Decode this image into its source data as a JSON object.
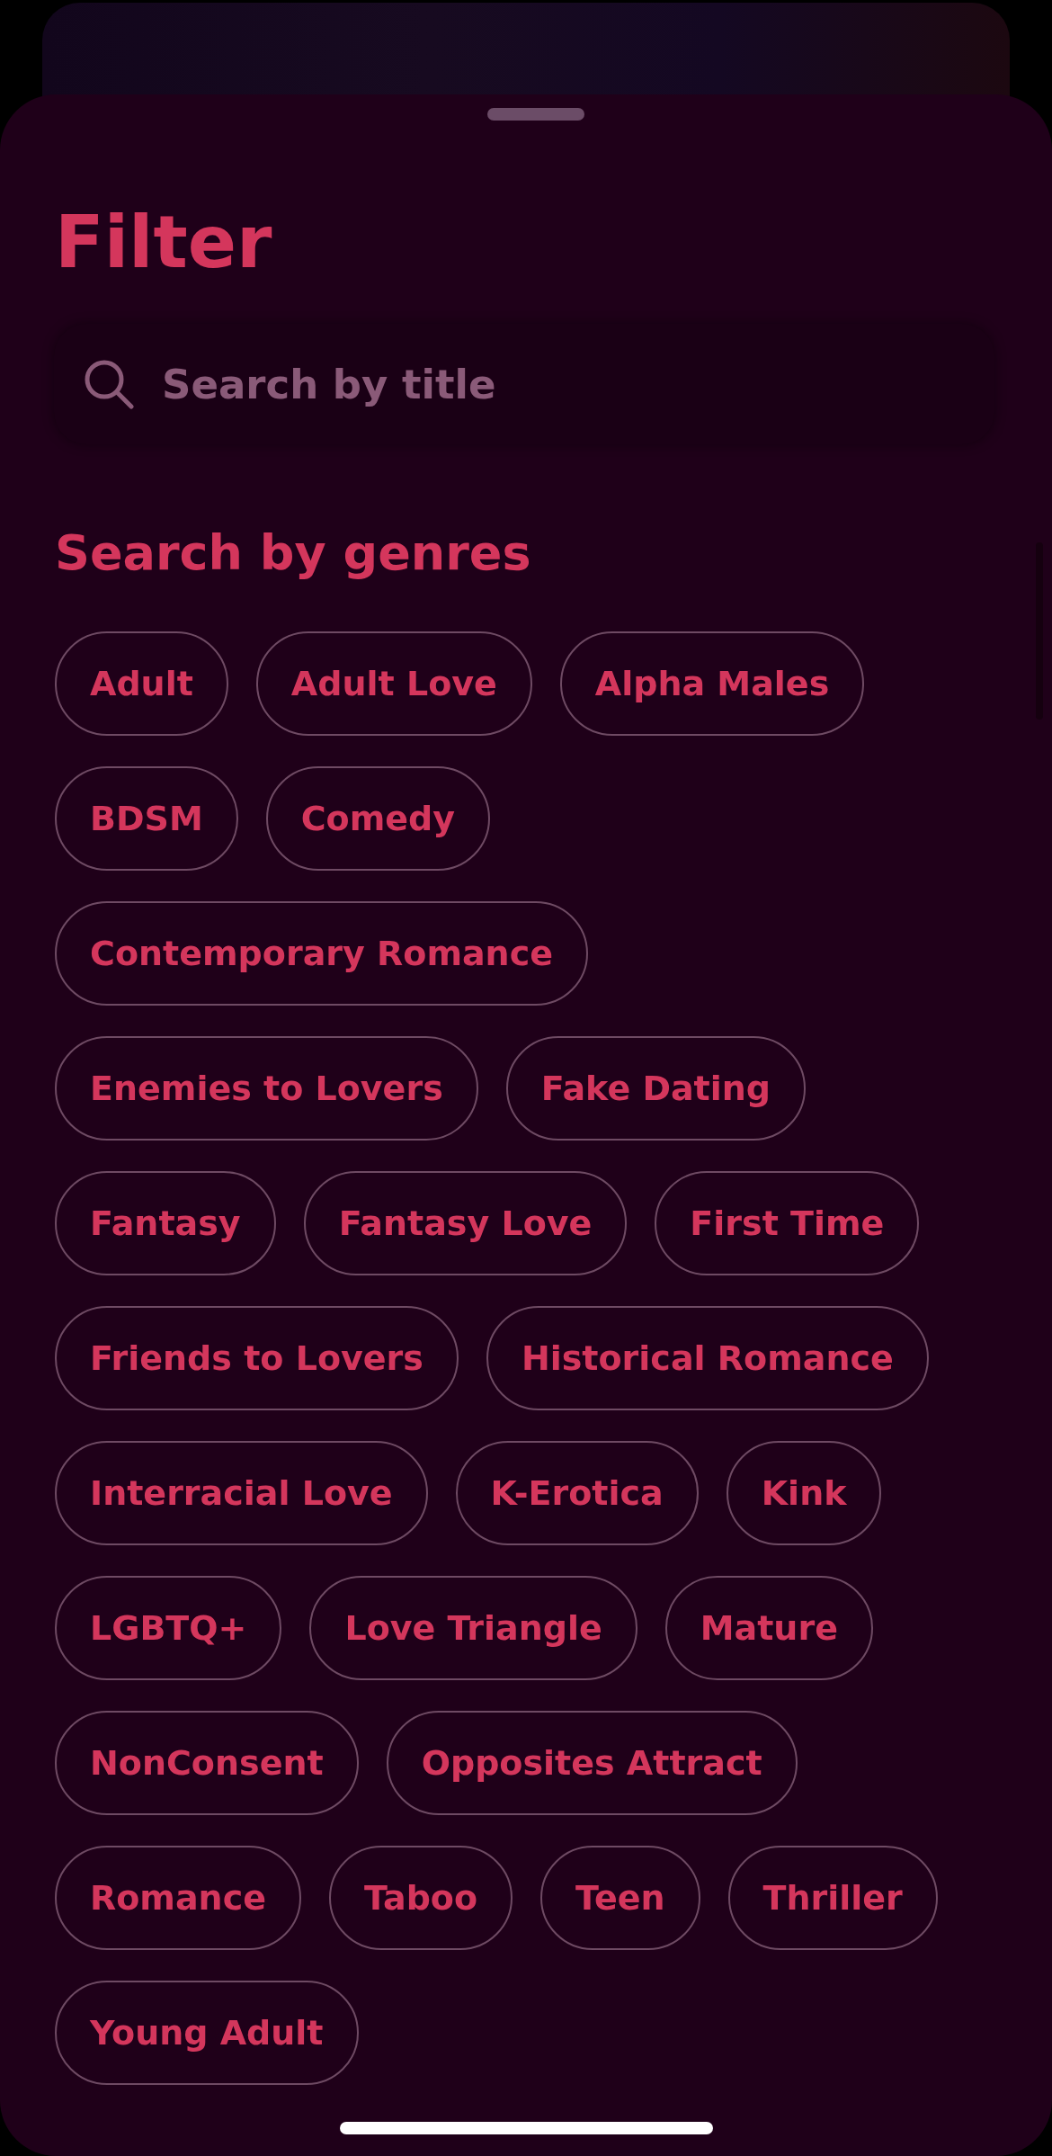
{
  "sheet": {
    "title": "Filter",
    "search": {
      "placeholder": "Search by title"
    },
    "genres_heading": "Search by genres",
    "genres": [
      {
        "label": "Adult",
        "selected": false
      },
      {
        "label": "Adult Love",
        "selected": false
      },
      {
        "label": "Alpha Males",
        "selected": false
      },
      {
        "label": "BDSM",
        "selected": false
      },
      {
        "label": "Comedy",
        "selected": false
      },
      {
        "label": "Contemporary Romance",
        "selected": false
      },
      {
        "label": "Enemies to Lovers",
        "selected": false
      },
      {
        "label": "Fake Dating",
        "selected": false
      },
      {
        "label": "Fantasy",
        "selected": false
      },
      {
        "label": "Fantasy Love",
        "selected": false
      },
      {
        "label": "First Time",
        "selected": false
      },
      {
        "label": "Friends to Lovers",
        "selected": false
      },
      {
        "label": "Historical Romance",
        "selected": false
      },
      {
        "label": "Interracial Love",
        "selected": false
      },
      {
        "label": "K-Erotica",
        "selected": false
      },
      {
        "label": "Kink",
        "selected": false
      },
      {
        "label": "LGBTQ+",
        "selected": false
      },
      {
        "label": "Love Triangle",
        "selected": false
      },
      {
        "label": "Mature",
        "selected": false
      },
      {
        "label": "NonConsent",
        "selected": false
      },
      {
        "label": "Opposites Attract",
        "selected": false
      },
      {
        "label": "Romance",
        "selected": false
      },
      {
        "label": "Taboo",
        "selected": false
      },
      {
        "label": "Teen",
        "selected": false
      },
      {
        "label": "Thriller",
        "selected": false
      },
      {
        "label": "Young Adult",
        "selected": false
      }
    ]
  }
}
